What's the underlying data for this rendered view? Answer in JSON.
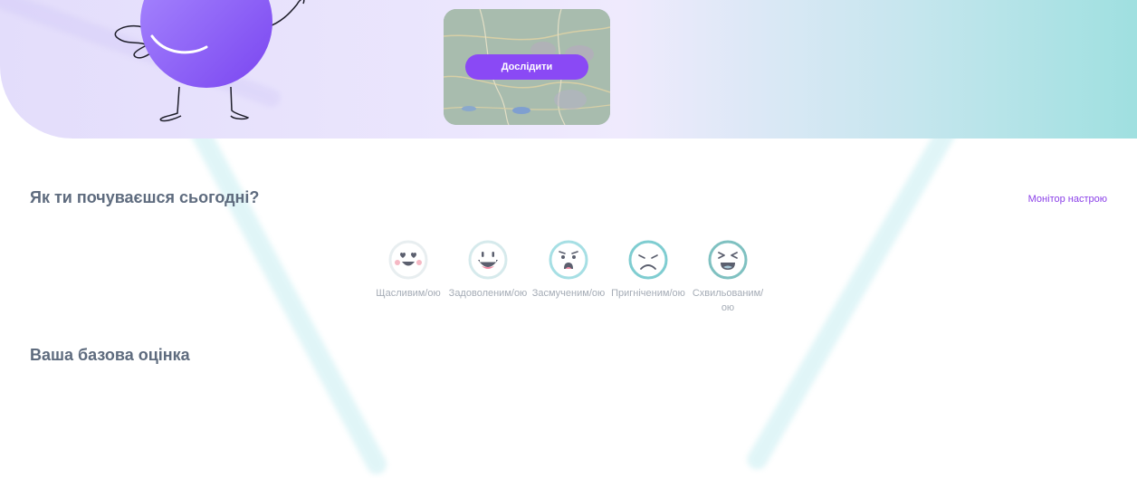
{
  "hero": {
    "explore_button": "Дослідити"
  },
  "mood_section": {
    "question": "Як ти почуваєшся сьогодні?",
    "monitor_link": "Монітор настрою",
    "moods": [
      {
        "label": "Щасливим/ою",
        "icon": "happy-heart-eyes-icon",
        "color": "#e8eef0"
      },
      {
        "label": "Задоволеним/ою",
        "icon": "content-smile-icon",
        "color": "#d6eaec"
      },
      {
        "label": "Засмученим/ою",
        "icon": "upset-face-icon",
        "color": "#a6dfe4"
      },
      {
        "label": "Пригніченим/ою",
        "icon": "sad-face-icon",
        "color": "#7fcdd1"
      },
      {
        "label": "Схвильованим/ою",
        "icon": "anxious-face-icon",
        "color": "#7fc1c1"
      }
    ]
  },
  "base_score": {
    "title": "Ваша базова оцінка"
  },
  "colors": {
    "accent": "#8a49f5",
    "heading": "#5e6b7e",
    "muted_label": "#a5acb6"
  }
}
